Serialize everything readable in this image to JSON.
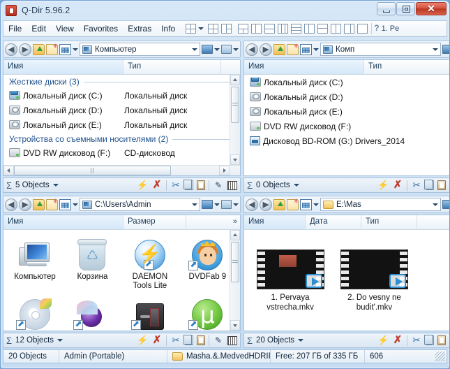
{
  "window": {
    "title": "Q-Dir 5.96.2",
    "app_icon": "qdir-app-icon",
    "buttons": {
      "minimize": "minimize",
      "maximize": "maximize",
      "close": "✕"
    }
  },
  "menubar": {
    "items": [
      "File",
      "Edit",
      "View",
      "Favorites",
      "Extras",
      "Info"
    ],
    "layout_buttons": [
      "layout-quad",
      "layout-4-split",
      "layout-3-right",
      "layout-3-bottom",
      "layout-2-vertical",
      "layout-2-horizontal",
      "layout-3-cols",
      "layout-3-rows",
      "layout-2-cols",
      "layout-top-split",
      "layout-left-split",
      "layout-right-split",
      "layout-single"
    ],
    "inet_label": "1. Pe"
  },
  "panes": [
    {
      "id": "top-left",
      "address": "Компьютер",
      "address_icon": "computer-icon",
      "columns": [
        "Имя",
        "Тип"
      ],
      "groups": [
        {
          "label": "Жесткие диски (3)",
          "rows": [
            {
              "name": "Локальный диск (C:)",
              "type": "Локальный диск",
              "icon": "system-drive-icon"
            },
            {
              "name": "Локальный диск (D:)",
              "type": "Локальный диск",
              "icon": "drive-icon"
            },
            {
              "name": "Локальный диск (E:)",
              "type": "Локальный диск",
              "icon": "drive-icon"
            }
          ]
        },
        {
          "label": "Устройства со съемными носителями (2)",
          "rows": [
            {
              "name": "DVD RW дисковод (F:)",
              "type": "CD-дисковод",
              "icon": "cd-drive-icon"
            }
          ]
        }
      ],
      "status": {
        "objects": "5 Objects"
      }
    },
    {
      "id": "top-right",
      "address": "Комп",
      "address_icon": "computer-icon",
      "columns": [
        "Имя",
        "Тип"
      ],
      "rows": [
        {
          "name": "Локальный диск (C:)",
          "icon": "system-drive-icon"
        },
        {
          "name": "Локальный диск (D:)",
          "icon": "drive-icon"
        },
        {
          "name": "Локальный диск (E:)",
          "icon": "drive-icon"
        },
        {
          "name": "DVD RW дисковод (F:)",
          "icon": "cd-drive-icon"
        },
        {
          "name": "Дисковод BD-ROM (G:) Drivers_2014",
          "icon": "bd-rom-icon"
        }
      ],
      "status": {
        "objects": "0 Objects"
      }
    },
    {
      "id": "bottom-left",
      "address": "C:\\Users\\Admin",
      "address_icon": "computer-icon",
      "columns": [
        "Имя",
        "Размер"
      ],
      "icons": [
        {
          "label": "Компьютер",
          "art": "computer-art",
          "shortcut": false
        },
        {
          "label": "Корзина",
          "art": "recycle-bin-art",
          "shortcut": false
        },
        {
          "label": "DAEMON Tools Lite",
          "art": "daemon-tools-art",
          "shortcut": true
        },
        {
          "label": "DVDFab 9",
          "art": "dvdfab-art",
          "shortcut": true
        },
        {
          "label": "",
          "art": "cd-disc-art",
          "shortcut": true
        },
        {
          "label": "",
          "art": "nero-art",
          "shortcut": true
        },
        {
          "label": "",
          "art": "safe-art",
          "shortcut": true
        },
        {
          "label": "",
          "art": "utorrent-art",
          "shortcut": true
        }
      ],
      "status": {
        "objects": "12 Objects"
      }
    },
    {
      "id": "bottom-right",
      "address": "E:\\Mas",
      "address_icon": "folder-icon",
      "columns": [
        "Имя",
        "Дата",
        "Тип"
      ],
      "thumbnails": [
        {
          "label": "1. Pervaya vstrecha.mkv",
          "art": "sunflower-thumb"
        },
        {
          "label": "2. Do vesny ne budit'.mkv",
          "art": "bear-thumb"
        }
      ],
      "status": {
        "objects": "20 Objects"
      }
    }
  ],
  "pane_status_icons": [
    "flash-icon",
    "delete-icon",
    "cut-icon",
    "copy-icon",
    "paste-icon",
    "pen-icon",
    "grid-icon"
  ],
  "window_status": {
    "objects": "20 Objects",
    "user": "Admin (Portable)",
    "folder": "Masha.&.MedvedHDRIP",
    "free_space": "Free: 207 ГБ of 335 ГБ",
    "extra": "606"
  },
  "colors": {
    "accent": "#2c8fd4",
    "group_heading": "#21538f",
    "close_button": "#bb3621",
    "frame": "#6f9ed4"
  }
}
